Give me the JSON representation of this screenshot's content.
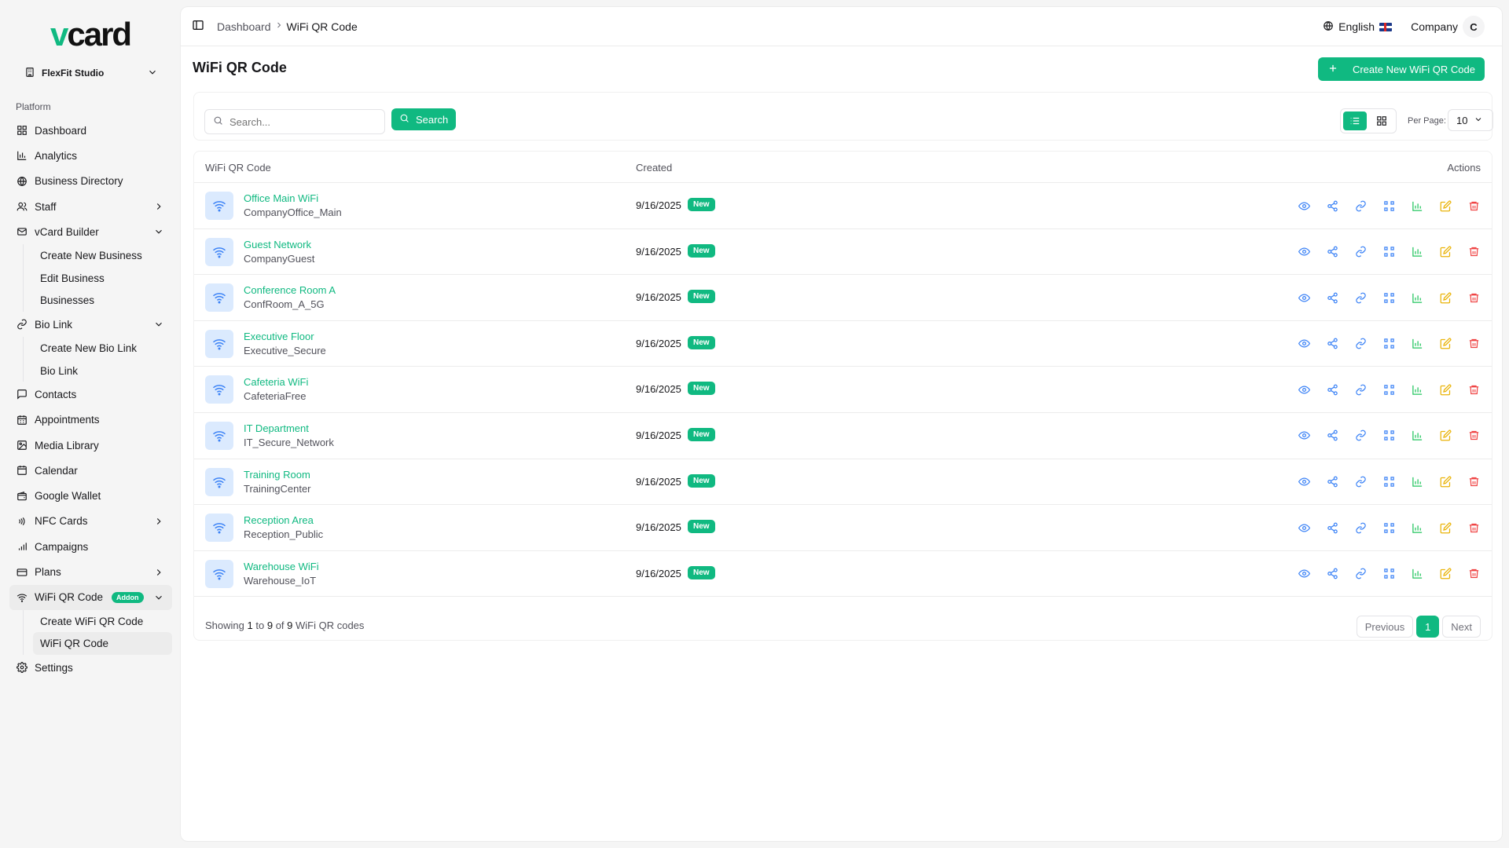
{
  "brand": {
    "logo_v": "v",
    "logo_rest": "card"
  },
  "org": {
    "name": "FlexFit Studio"
  },
  "sidebar": {
    "section_label": "Platform",
    "items": [
      {
        "label": "Dashboard",
        "icon": "grid-icon"
      },
      {
        "label": "Analytics",
        "icon": "bar-chart-icon"
      },
      {
        "label": "Business Directory",
        "icon": "globe-icon"
      },
      {
        "label": "Staff",
        "icon": "users-icon"
      },
      {
        "label": "vCard Builder",
        "icon": "mail-icon"
      },
      {
        "label": "Bio Link",
        "icon": "link-icon"
      },
      {
        "label": "Contacts",
        "icon": "message-icon"
      },
      {
        "label": "Appointments",
        "icon": "calendar-grid-icon"
      },
      {
        "label": "Media Library",
        "icon": "image-icon"
      },
      {
        "label": "Calendar",
        "icon": "calendar-icon"
      },
      {
        "label": "Google Wallet",
        "icon": "wallet-icon"
      },
      {
        "label": "NFC Cards",
        "icon": "nfc-icon"
      },
      {
        "label": "Campaigns",
        "icon": "signal-icon"
      },
      {
        "label": "Plans",
        "icon": "card-icon"
      },
      {
        "label": "WiFi QR Code",
        "icon": "wifi-icon",
        "badge": "Addon"
      },
      {
        "label": "Settings",
        "icon": "gear-icon"
      }
    ],
    "vcard_sub": [
      "Create New Business",
      "Edit Business",
      "Businesses"
    ],
    "biolink_sub": [
      "Create New Bio Link",
      "Bio Link"
    ],
    "wifi_sub": [
      "Create WiFi QR Code",
      "WiFi QR Code"
    ]
  },
  "topbar": {
    "crumb_home": "Dashboard",
    "crumb_current": "WiFi QR Code",
    "language": "English",
    "company": "Company",
    "avatar_initial": "C"
  },
  "page": {
    "title": "WiFi QR Code",
    "create_label": "Create New WiFi QR Code"
  },
  "filters": {
    "search_placeholder": "Search...",
    "search_label": "Search",
    "per_page_label": "Per Page:",
    "per_page_value": "10"
  },
  "table": {
    "col_name": "WiFi QR Code",
    "col_created": "Created",
    "col_actions": "Actions",
    "rows": [
      {
        "name": "Office Main WiFi",
        "ssid": "CompanyOffice_Main",
        "created": "9/16/2025",
        "badge": "New"
      },
      {
        "name": "Guest Network",
        "ssid": "CompanyGuest",
        "created": "9/16/2025",
        "badge": "New"
      },
      {
        "name": "Conference Room A",
        "ssid": "ConfRoom_A_5G",
        "created": "9/16/2025",
        "badge": "New"
      },
      {
        "name": "Executive Floor",
        "ssid": "Executive_Secure",
        "created": "9/16/2025",
        "badge": "New"
      },
      {
        "name": "Cafeteria WiFi",
        "ssid": "CafeteriaFree",
        "created": "9/16/2025",
        "badge": "New"
      },
      {
        "name": "IT Department",
        "ssid": "IT_Secure_Network",
        "created": "9/16/2025",
        "badge": "New"
      },
      {
        "name": "Training Room",
        "ssid": "TrainingCenter",
        "created": "9/16/2025",
        "badge": "New"
      },
      {
        "name": "Reception Area",
        "ssid": "Reception_Public",
        "created": "9/16/2025",
        "badge": "New"
      },
      {
        "name": "Warehouse WiFi",
        "ssid": "Warehouse_IoT",
        "created": "9/16/2025",
        "badge": "New"
      }
    ],
    "action_icons": [
      "eye-icon",
      "share-icon",
      "link-icon",
      "qr-icon",
      "analytics-icon",
      "edit-icon",
      "trash-icon"
    ]
  },
  "footer": {
    "showing_prefix": "Showing",
    "from": "1",
    "to_word": "to",
    "to": "9",
    "of_word": "of",
    "total": "9",
    "suffix": "WiFi QR codes",
    "previous": "Previous",
    "page": "1",
    "next": "Next"
  },
  "colors": {
    "accent": "#10b981",
    "action_blue": "#3b82f6",
    "action_yellow": "#eab308",
    "action_red": "#ef4444",
    "action_green": "#22c55e"
  }
}
